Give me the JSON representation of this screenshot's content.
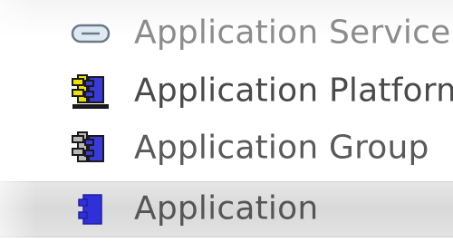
{
  "menu": {
    "items": [
      {
        "label": "Application Service",
        "icon": "application-service-icon",
        "state": "dimmed"
      },
      {
        "label": "Application Platform",
        "icon": "application-platform-icon",
        "state": "normal"
      },
      {
        "label": "Application Group",
        "icon": "application-group-icon",
        "state": "normal"
      },
      {
        "label": "Application",
        "icon": "application-icon",
        "state": "highlighted"
      }
    ]
  },
  "colors": {
    "component_blue": "#3a3ad8",
    "platform_yellow": "#f0e000",
    "group_gray": "#9a9a9a",
    "highlight_bg": "#dcdcdc"
  }
}
